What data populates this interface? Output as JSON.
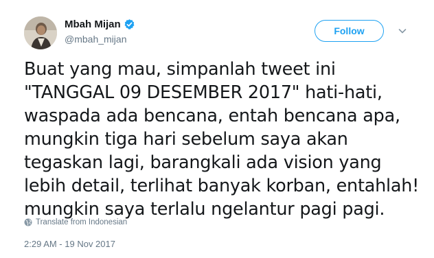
{
  "author": {
    "name": "Mbah Mijan",
    "handle": "@mbah_mijan",
    "avatar_icon": "user-avatar-photo",
    "verified_icon": "verified-badge-icon"
  },
  "header": {
    "follow_label": "Follow",
    "menu_icon": "chevron-down-icon"
  },
  "tweet": {
    "text": "Buat yang mau, simpanlah tweet ini\n\"TANGGAL 09 DESEMBER 2017\" hati-hati,\nwaspada ada bencana, entah bencana apa,\nmungkin tiga hari sebelum saya akan\ntegaskan lagi, barangkali ada vision yang\nlebih detail, terlihat banyak korban, entahlah!\nmungkin saya terlalu ngelantur pagi pagi."
  },
  "translate": {
    "label": "Translate from Indonesian",
    "icon": "globe-icon"
  },
  "timestamp": "2:29 AM - 19 Nov 2017",
  "colors": {
    "accent": "#1da1f2",
    "text": "#14171a",
    "secondary": "#657786",
    "background": "#ffffff"
  }
}
